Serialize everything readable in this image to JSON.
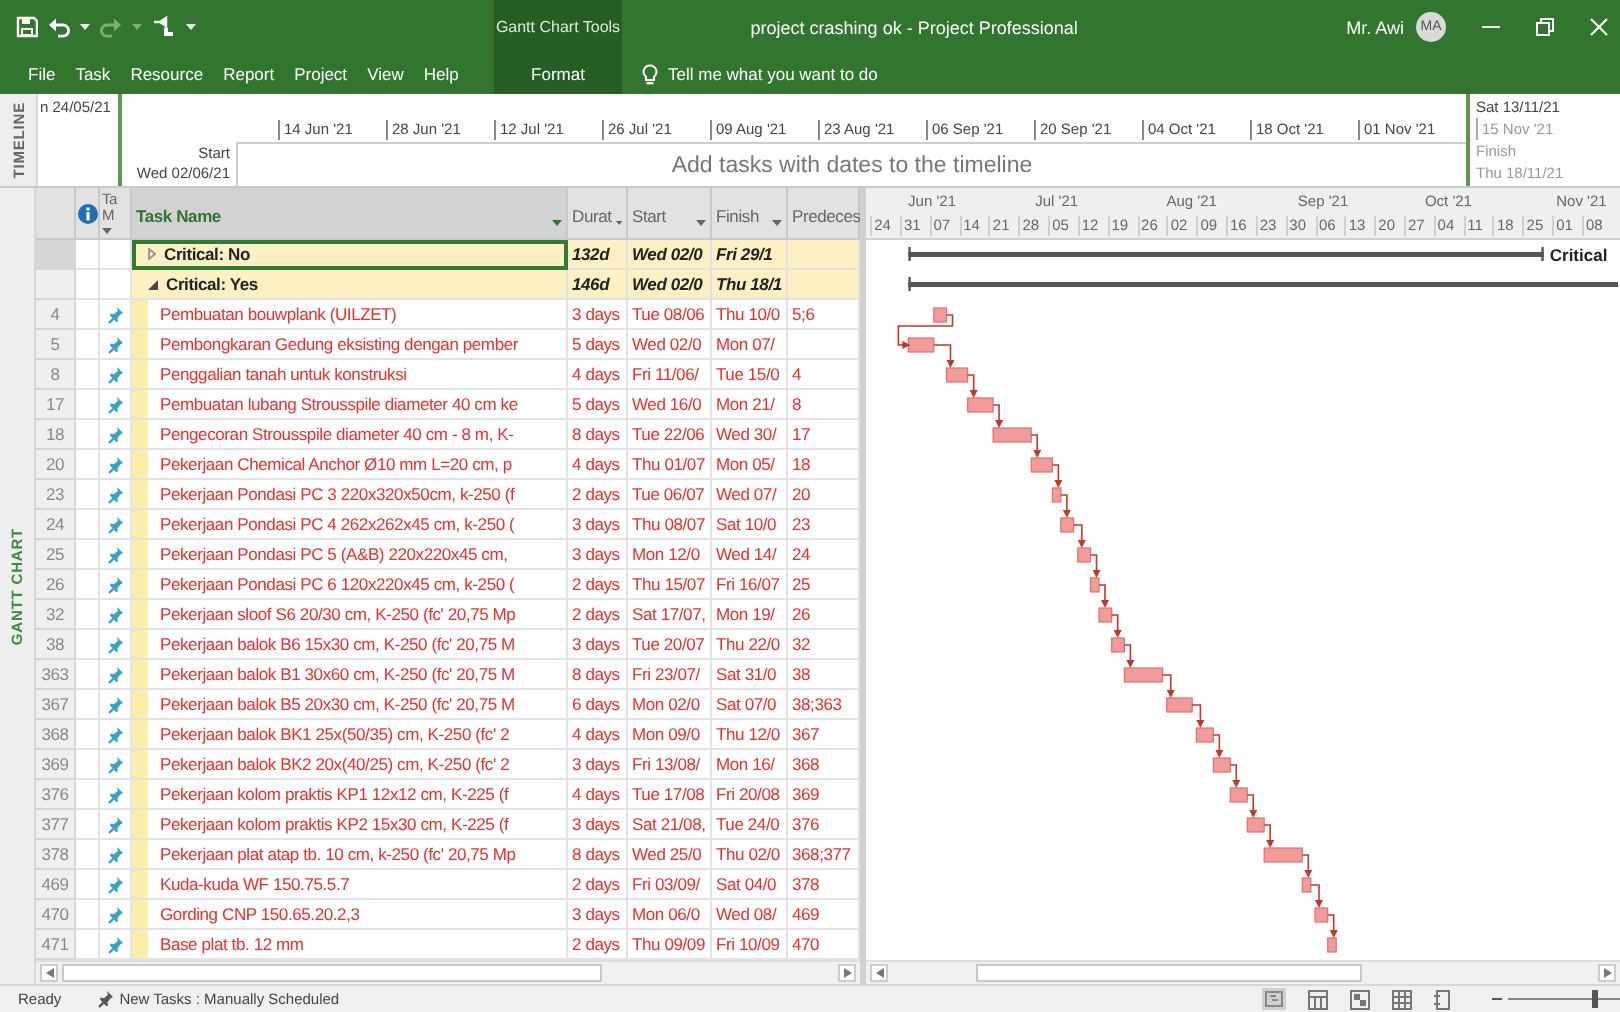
{
  "title_bar": {
    "context_tab": "Gantt Chart Tools",
    "title": "project crashing ok  -  Project Professional",
    "user": "Mr. Awi",
    "avatar_initials": "MA"
  },
  "ribbon": {
    "tabs": [
      {
        "label": "File",
        "kind": "standard",
        "selected": false
      },
      {
        "label": "Task",
        "kind": "standard",
        "selected": false
      },
      {
        "label": "Resource",
        "kind": "standard",
        "selected": false
      },
      {
        "label": "Report",
        "kind": "standard",
        "selected": false
      },
      {
        "label": "Project",
        "kind": "standard",
        "selected": false
      },
      {
        "label": "View",
        "kind": "standard",
        "selected": false
      },
      {
        "label": "Help",
        "kind": "standard",
        "selected": false
      },
      {
        "label": "Format",
        "kind": "context",
        "selected": false
      }
    ],
    "tell_me": "Tell me what you want to do"
  },
  "timeline": {
    "side_label": "TIMELINE",
    "range_start": "n 24/05/21",
    "start_label": "Start",
    "start_date": "Wed 02/06/21",
    "ticks": [
      "14 Jun '21",
      "28 Jun '21",
      "12 Jul '21",
      "26 Jul '21",
      "09 Aug '21",
      "23 Aug '21",
      "06 Sep '21",
      "20 Sep '21",
      "04 Oct '21",
      "18 Oct '21",
      "01 Nov '21"
    ],
    "hint": "Add tasks with dates to the timeline",
    "range_end": "Sat 13/11/21",
    "end_tick": "15 Nov '21",
    "finish_label": "Finish",
    "finish_date": "Thu 18/11/21"
  },
  "gantt_view": {
    "side_label": "GANTT CHART",
    "columns": [
      {
        "kind": "indicators"
      },
      {
        "kind": "mode",
        "label": "Ta M",
        "selected": false
      },
      {
        "kind": "name",
        "label": "Task Name",
        "selected": true
      },
      {
        "kind": "duration",
        "label": "Durat",
        "selected": false
      },
      {
        "kind": "start",
        "label": "Start",
        "selected": false
      },
      {
        "kind": "finish",
        "label": "Finish",
        "selected": false
      },
      {
        "kind": "predecessors",
        "label": "Predeces",
        "selected": false
      }
    ],
    "rows": [
      {
        "kind": "group",
        "name": "Critical: No",
        "expanded": false,
        "selected": true,
        "duration": "132d",
        "start": "Wed 02/0",
        "finish": "Fri 29/1"
      },
      {
        "kind": "group",
        "name": "Critical: Yes",
        "expanded": true,
        "selected": false,
        "duration": "146d",
        "start": "Wed 02/0",
        "finish": "Thu 18/1"
      },
      {
        "kind": "task",
        "id": "4",
        "manually_scheduled": true,
        "critical": true,
        "name": "Pembuatan bouwplank (UILZET)",
        "duration": "3 days",
        "start": "Tue 08/06",
        "finish": "Thu 10/0",
        "predecessors": "5;6"
      },
      {
        "kind": "task",
        "id": "5",
        "manually_scheduled": true,
        "critical": true,
        "name": "Pembongkaran Gedung eksisting dengan pember",
        "duration": "5 days",
        "start": "Wed 02/0",
        "finish": "Mon 07/"
      },
      {
        "kind": "task",
        "id": "8",
        "manually_scheduled": true,
        "critical": true,
        "name": "Penggalian tanah untuk konstruksi",
        "duration": "4 days",
        "start": "Fri 11/06/",
        "finish": "Tue 15/0",
        "predecessors": "4"
      },
      {
        "kind": "task",
        "id": "17",
        "manually_scheduled": true,
        "critical": true,
        "name": "Pembuatan lubang Strousspile diameter 40 cm ke",
        "duration": "5 days",
        "start": "Wed 16/0",
        "finish": "Mon 21/",
        "predecessors": "8"
      },
      {
        "kind": "task",
        "id": "18",
        "manually_scheduled": true,
        "critical": true,
        "name": "Pengecoran Strousspile diameter 40 cm - 8 m, K-",
        "duration": "8 days",
        "start": "Tue 22/06",
        "finish": "Wed 30/",
        "predecessors": "17"
      },
      {
        "kind": "task",
        "id": "20",
        "manually_scheduled": true,
        "critical": true,
        "name": "Pekerjaan Chemical Anchor Ø10 mm L=20 cm, p",
        "duration": "4 days",
        "start": "Thu 01/07",
        "finish": "Mon 05/",
        "predecessors": "18"
      },
      {
        "kind": "task",
        "id": "23",
        "manually_scheduled": true,
        "critical": true,
        "name": "Pekerjaan Pondasi PC 3 220x320x50cm, k-250 (f",
        "duration": "2 days",
        "start": "Tue 06/07",
        "finish": "Wed 07/",
        "predecessors": "20"
      },
      {
        "kind": "task",
        "id": "24",
        "manually_scheduled": true,
        "critical": true,
        "name": "Pekerjaan Pondasi PC 4 262x262x45 cm, k-250 (",
        "duration": "3 days",
        "start": "Thu 08/07",
        "finish": "Sat 10/0",
        "predecessors": "23"
      },
      {
        "kind": "task",
        "id": "25",
        "manually_scheduled": true,
        "critical": true,
        "name": "Pekerjaan Pondasi PC 5 (A&B) 220x220x45 cm,",
        "duration": "3 days",
        "start": "Mon 12/0",
        "finish": "Wed 14/",
        "predecessors": "24"
      },
      {
        "kind": "task",
        "id": "26",
        "manually_scheduled": true,
        "critical": true,
        "name": "Pekerjaan Pondasi PC 6 120x220x45 cm, k-250 (",
        "duration": "2 days",
        "start": "Thu 15/07",
        "finish": "Fri 16/07",
        "predecessors": "25"
      },
      {
        "kind": "task",
        "id": "32",
        "manually_scheduled": true,
        "critical": true,
        "name": "Pekerjaan sloof S6 20/30 cm, K-250 (fc' 20,75 Mp",
        "duration": "2 days",
        "start": "Sat 17/07,",
        "finish": "Mon 19/",
        "predecessors": "26"
      },
      {
        "kind": "task",
        "id": "38",
        "manually_scheduled": true,
        "critical": true,
        "name": "Pekerjaan balok B6 15x30 cm, K-250 (fc' 20,75 M",
        "duration": "3 days",
        "start": "Tue 20/07",
        "finish": "Thu 22/0",
        "predecessors": "32"
      },
      {
        "kind": "task",
        "id": "363",
        "manually_scheduled": true,
        "critical": true,
        "name": "Pekerjaan balok B1 30x60 cm, K-250 (fc' 20,75 M",
        "duration": "8 days",
        "start": "Fri 23/07/",
        "finish": "Sat 31/0",
        "predecessors": "38"
      },
      {
        "kind": "task",
        "id": "367",
        "manually_scheduled": true,
        "critical": true,
        "name": "Pekerjaan balok B5 20x30 cm, K-250 (fc' 20,75 M",
        "duration": "6 days",
        "start": "Mon 02/0",
        "finish": "Sat 07/0",
        "predecessors": "38;363"
      },
      {
        "kind": "task",
        "id": "368",
        "manually_scheduled": true,
        "critical": true,
        "name": "Pekerjaan balok BK1 25x(50/35) cm, K-250 (fc' 2",
        "duration": "4 days",
        "start": "Mon 09/0",
        "finish": "Thu 12/0",
        "predecessors": "367"
      },
      {
        "kind": "task",
        "id": "369",
        "manually_scheduled": true,
        "critical": true,
        "name": "Pekerjaan balok BK2 20x(40/25) cm, K-250 (fc' 2",
        "duration": "3 days",
        "start": "Fri 13/08/",
        "finish": "Mon 16/",
        "predecessors": "368"
      },
      {
        "kind": "task",
        "id": "376",
        "manually_scheduled": true,
        "critical": true,
        "name": "Pekerjaan kolom praktis KP1 12x12 cm, K-225 (f",
        "duration": "4 days",
        "start": "Tue 17/08",
        "finish": "Fri 20/08",
        "predecessors": "369"
      },
      {
        "kind": "task",
        "id": "377",
        "manually_scheduled": true,
        "critical": true,
        "name": "Pekerjaan kolom praktis KP2 15x30 cm, K-225 (f",
        "duration": "3 days",
        "start": "Sat 21/08,",
        "finish": "Tue 24/0",
        "predecessors": "376"
      },
      {
        "kind": "task",
        "id": "378",
        "manually_scheduled": true,
        "critical": true,
        "name": "Pekerjaan plat atap tb. 10 cm, k-250 (fc' 20,75 Mp",
        "duration": "8 days",
        "start": "Wed 25/0",
        "finish": "Thu 02/0",
        "predecessors": "368;377"
      },
      {
        "kind": "task",
        "id": "469",
        "manually_scheduled": true,
        "critical": true,
        "name": "Kuda-kuda WF 150.75.5.7",
        "duration": "2 days",
        "start": "Fri 03/09/",
        "finish": "Sat 04/0",
        "predecessors": "378"
      },
      {
        "kind": "task",
        "id": "470",
        "manually_scheduled": true,
        "critical": true,
        "name": "Gording CNP 150.65.20.2,3",
        "duration": "3 days",
        "start": "Mon 06/0",
        "finish": "Wed 08/",
        "predecessors": "469"
      },
      {
        "kind": "task",
        "id": "471",
        "manually_scheduled": true,
        "critical": true,
        "name": "Base plat tb. 12 mm",
        "duration": "2 days",
        "start": "Thu 09/09",
        "finish": "Fri 10/09",
        "predecessors": "470"
      }
    ],
    "timescale": {
      "months": [
        "Jun '21",
        "Jul '21",
        "Aug '21",
        "Sep '21",
        "Oct '21",
        "Nov '21"
      ],
      "weeks": [
        "24",
        "31",
        "07",
        "14",
        "21",
        "28",
        "05",
        "12",
        "19",
        "26",
        "02",
        "09",
        "16",
        "23",
        "30",
        "06",
        "13",
        "20",
        "27",
        "04",
        "11",
        "18",
        "25",
        "01",
        "08"
      ]
    },
    "summary_bar_label": "Critical"
  },
  "status_bar": {
    "status": "Ready",
    "new_tasks_mode": "New Tasks : Manually Scheduled",
    "zoom": {
      "level": 0.78
    }
  }
}
